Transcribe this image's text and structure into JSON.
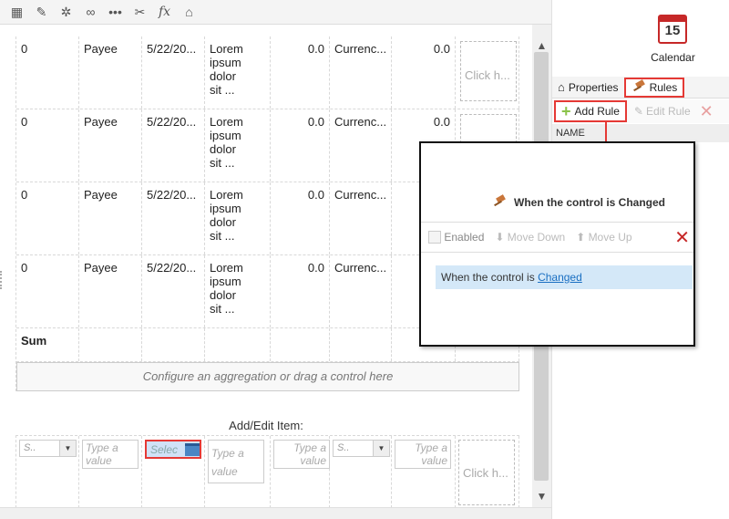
{
  "toolbar": {
    "icons": [
      "table-icon",
      "edit-form-icon",
      "gear-icon",
      "link-icon",
      "more-icon",
      "tools-icon",
      "fx-icon",
      "graduation-cap-icon"
    ],
    "fx_label": "fx",
    "more_label": "•••"
  },
  "grid": {
    "rows": [
      {
        "c1": "0",
        "c2": "Payee",
        "c3": "5/22/20...",
        "c4": [
          "Lorem",
          "ipsum",
          "dolor",
          "sit ..."
        ],
        "c5": "0.0",
        "c6": "Currenc...",
        "c7": "0.0",
        "click": "Click h..."
      },
      {
        "c1": "0",
        "c2": "Payee",
        "c3": "5/22/20...",
        "c4": [
          "Lorem",
          "ipsum",
          "dolor",
          "sit ..."
        ],
        "c5": "0.0",
        "c6": "Currenc...",
        "c7": "0.0",
        "click": ""
      },
      {
        "c1": "0",
        "c2": "Payee",
        "c3": "5/22/20...",
        "c4": [
          "Lorem",
          "ipsum",
          "dolor",
          "sit ..."
        ],
        "c5": "0.0",
        "c6": "Currenc...",
        "c7": "",
        "click": ""
      },
      {
        "c1": "0",
        "c2": "Payee",
        "c3": "5/22/20...",
        "c4": [
          "Lorem",
          "ipsum",
          "dolor",
          "sit ..."
        ],
        "c5": "0.0",
        "c6": "Currenc...",
        "c7": "",
        "click": ""
      }
    ],
    "sum_label": "Sum",
    "aggregation_placeholder": "Configure an aggregation or drag a control here"
  },
  "add_edit": {
    "title": "Add/Edit Item:",
    "dropdown1": "S..",
    "text1": "Type a value",
    "date": "Selec",
    "text2": "Type a value",
    "text3": "Type a value",
    "dropdown2": "S..",
    "text4": "Type a value",
    "click": "Click h..."
  },
  "scroll": {
    "up": "▲",
    "down": "▼"
  },
  "right_panel": {
    "calendar_day": "15",
    "calendar_label": "Calendar",
    "tab_properties": "Properties",
    "tab_rules": "Rules",
    "add_rule": "Add Rule",
    "edit_rule": "Edit Rule",
    "name_header": "NAME"
  },
  "popup": {
    "title": "When the control is Changed",
    "enabled_label": "Enabled",
    "move_down": "Move Down",
    "move_up": "Move Up",
    "rule_prefix": "When the control is",
    "rule_link": "Changed"
  }
}
